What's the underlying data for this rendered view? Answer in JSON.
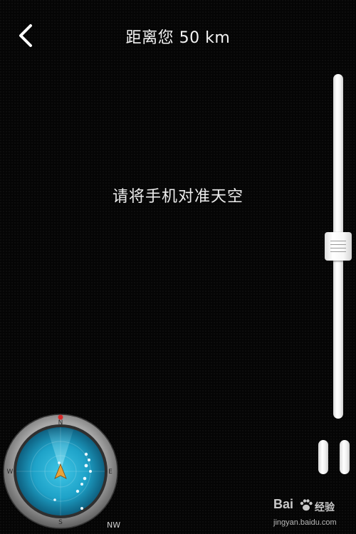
{
  "header": {
    "title": "距离您 50 km"
  },
  "main": {
    "message": "请将手机对准天空"
  },
  "slider": {
    "value_fraction": 0.5
  },
  "controls": {
    "pause_icon": "pause-icon",
    "back_icon": "chevron-left-icon"
  },
  "compass": {
    "directions": {
      "north": "N",
      "south": "S",
      "east": "E",
      "west": "W"
    },
    "heading": "NW",
    "colors": {
      "screen": "#1ea2c8",
      "bezel": "#8c8c8c",
      "marker": "#e8a33a"
    }
  },
  "watermark": {
    "brand": "Bai",
    "brand_suffix": "经验",
    "url": "jingyan.baidu.com"
  }
}
